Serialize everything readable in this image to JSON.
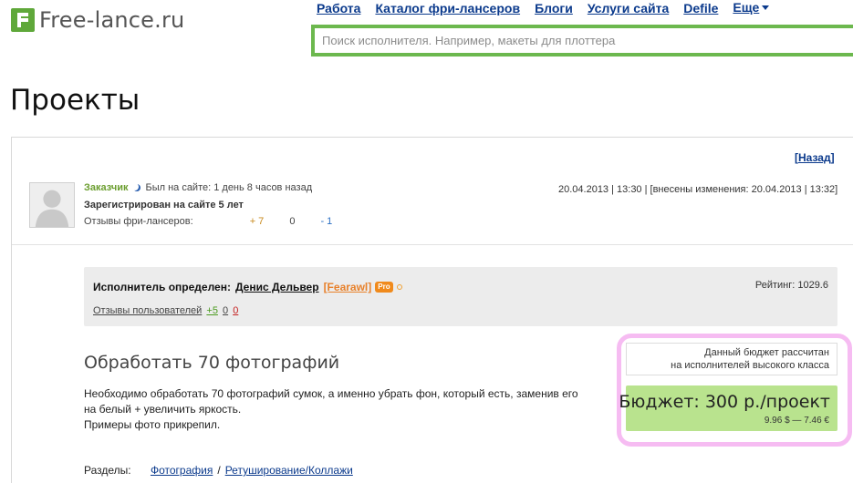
{
  "header": {
    "logo_text": "Free-lance.ru",
    "nav": [
      {
        "label": "Работа"
      },
      {
        "label": "Каталог фри-лансеров"
      },
      {
        "label": "Блоги"
      },
      {
        "label": "Услуги сайта"
      },
      {
        "label": "Defile"
      },
      {
        "label": "Еще"
      }
    ],
    "search_placeholder": "Поиск исполнителя. Например, макеты для плоттера"
  },
  "page": {
    "title": "Проекты",
    "back_label": "Назад",
    "back_open": "[",
    "back_close": "]"
  },
  "customer": {
    "name": "Заказчик",
    "last_seen": "Был на сайте: 1 день 8 часов назад",
    "registered": "Зарегистрирован на сайте 5 лет",
    "reviews_label": "Отзывы фри-лансеров:",
    "reviews_positive": "+ 7",
    "reviews_neutral": "0",
    "reviews_negative": "- 1"
  },
  "dates": "20.04.2013 | 13:30 | [внесены изменения: 20.04.2013 | 13:32]",
  "executor": {
    "label": "Исполнитель определен:",
    "name": "Денис Дельвер",
    "login": "[Fearawl]",
    "pro_badge": "Pro",
    "rating": "Рейтинг: 1029.6",
    "reviews_label": "Отзывы пользователей",
    "reviews_positive": "+5",
    "reviews_neutral": "0",
    "reviews_negative": "0"
  },
  "project": {
    "title": "Обработать 70 фотографий",
    "description_line1": "Необходимо обработать 70 фотографий сумок, а именно убрать фон, который есть, заменив его",
    "description_line2": "на белый + увеличить яркость.",
    "description_line3": "Примеры фото прикрепил.",
    "sections_label": "Разделы:",
    "section_1": "Фотография",
    "section_sep": "/",
    "section_2": "Ретуширование/Коллажи"
  },
  "budget": {
    "note_line1": "Данный бюджет рассчитан",
    "note_line2": "на исполнителей высокого класса",
    "main": "Бюджет: 300 р./проект",
    "converted": "9.96 $ — 7.46 €"
  },
  "colors": {
    "brand_green": "#6cb84e",
    "link_blue": "#0b3a8c",
    "budget_green": "#b9e38e",
    "highlight_pink": "#f4b0f0",
    "pro_orange": "#f08a1c"
  }
}
